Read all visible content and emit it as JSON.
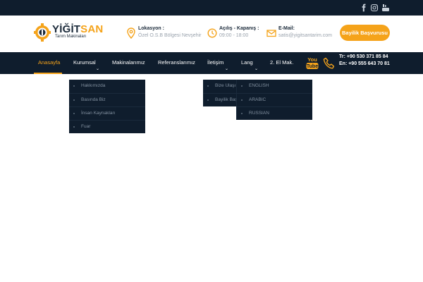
{
  "topbar": {
    "social": [
      {
        "name": "facebook-icon"
      },
      {
        "name": "instagram-icon"
      },
      {
        "name": "youtube-icon"
      }
    ]
  },
  "header": {
    "logo": {
      "brand_a": "YİĞİT",
      "brand_b": "SAN",
      "subtitle": "Tarım Makinaları"
    },
    "location": {
      "title": "Lokasyon :",
      "value": "Özel O.S.B Bölgesi Nevşehir"
    },
    "hours": {
      "title": "Açılış - Kapanış :",
      "value": "09:00 - 18:00"
    },
    "email": {
      "title": "E-Mail:",
      "value": "satis@yigitsantarim.com"
    },
    "dealer_button": "Bayilik Başvurusu"
  },
  "nav": {
    "items": [
      {
        "label": "Anasayfa"
      },
      {
        "label": "Kurumsal"
      },
      {
        "label": "Makinalarımız"
      },
      {
        "label": "Referanslarımız"
      },
      {
        "label": "İletişim"
      },
      {
        "label": "Lang"
      },
      {
        "label": "2. El Mak."
      }
    ],
    "phones": [
      "Tr: +90 530 371 85 84",
      "En: +90 555 643 70 81"
    ]
  },
  "dropdowns": {
    "kurumsal": [
      "Hakkımızda",
      "Basında Biz",
      "İnsan Kaynakları",
      "Fuar"
    ],
    "iletisim": [
      "Bize Ulaşı",
      "Bayilik Baş"
    ],
    "lang": [
      "ENGLISH",
      "ARABIC",
      "RUSSIAN"
    ]
  },
  "colors": {
    "navy": "#0f1d2d",
    "accent": "#f5a31a",
    "muted": "#9aa3ad"
  }
}
